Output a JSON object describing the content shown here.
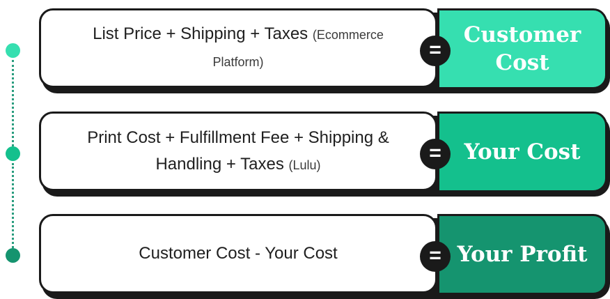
{
  "rows": [
    {
      "formula": "List Price + Shipping + Taxes",
      "source": "(Ecommerce Platform)",
      "equals": "=",
      "result": "Customer Cost",
      "result_color": "#36dfb0",
      "dot_color": "#36dfb0"
    },
    {
      "formula": "Print Cost + Fulfillment Fee + Shipping & Handling + Taxes",
      "source": "(Lulu)",
      "equals": "=",
      "result": "Your Cost",
      "result_color": "#14c08d",
      "dot_color": "#14c08d"
    },
    {
      "formula": "Customer Cost - Your Cost",
      "source": "",
      "equals": "=",
      "result": "Your Profit",
      "result_color": "#15946f",
      "dot_color": "#15946f"
    }
  ]
}
